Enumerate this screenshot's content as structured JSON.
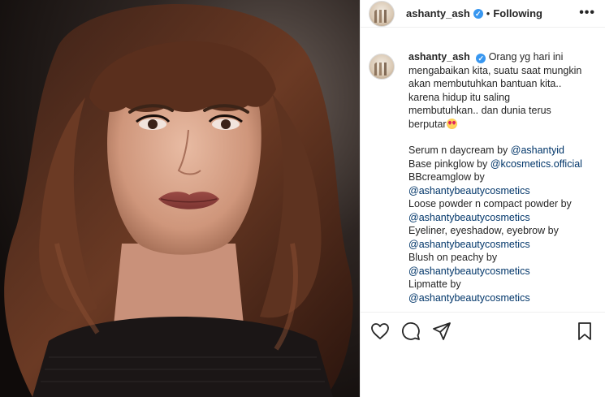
{
  "post": {
    "username": "ashanty_ash",
    "verified_mark": "✓",
    "separator": "•",
    "follow_status": "Following",
    "more_label": "•••"
  },
  "caption": {
    "username": "ashanty_ash",
    "lines_intro": [
      "Orang yg hari ini",
      "mengabaikan kita, suatu saat mungkin",
      "akan membutuhkan bantuan kita..",
      "karena hidup itu saling",
      "membutuhkan.. dan dunia terus",
      "berputar"
    ],
    "credits": [
      {
        "text": "Serum n daycream by ",
        "mention": "@ashantyid"
      },
      {
        "text": "Base pinkglow by ",
        "mention": "@kcosmetics.official"
      },
      {
        "text": "BBcreamglow by",
        "mention": ""
      },
      {
        "text": "",
        "mention": "@ashantybeautycosmetics"
      },
      {
        "text": "Loose powder n compact powder by",
        "mention": ""
      },
      {
        "text": "",
        "mention": "@ashantybeautycosmetics"
      },
      {
        "text": "Eyeliner, eyeshadow, eyebrow by",
        "mention": ""
      },
      {
        "text": "",
        "mention": "@ashantybeautycosmetics"
      },
      {
        "text": "Blush on peachy by",
        "mention": ""
      },
      {
        "text": "",
        "mention": "@ashantybeautycosmetics"
      },
      {
        "text": "Lipmatte by",
        "mention": ""
      },
      {
        "text": "",
        "mention": "@ashantybeautycosmetics"
      }
    ]
  },
  "icons": {
    "like": "heart-icon",
    "comment": "comment-icon",
    "share": "share-icon",
    "save": "bookmark-icon",
    "emoji": "heart-eyes-emoji"
  },
  "colors": {
    "mention": "#003569",
    "verified": "#3897f0",
    "text": "#262626",
    "divider": "#efefef"
  }
}
